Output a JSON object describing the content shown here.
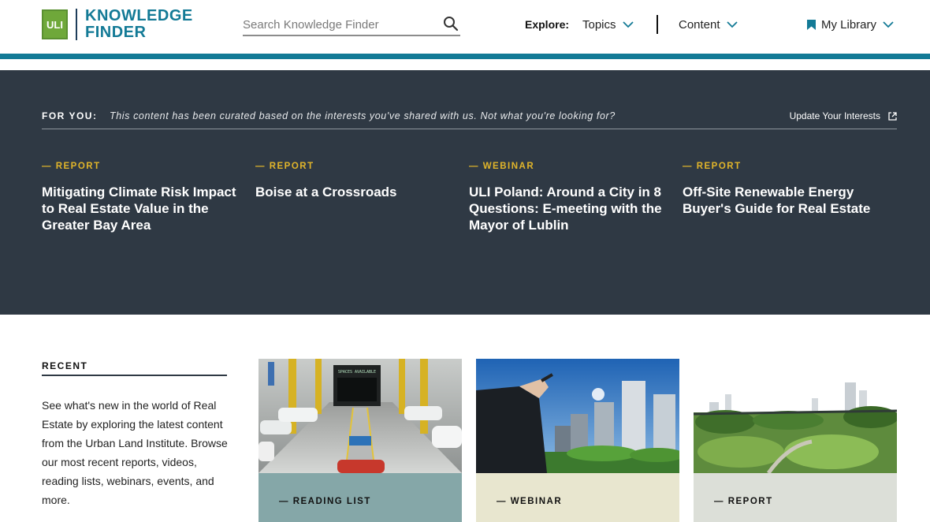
{
  "header": {
    "logo_box": "ULI",
    "logo_line1": "KNOWLEDGE",
    "logo_line2": "FINDER",
    "search_placeholder": "Search Knowledge Finder",
    "explore_label": "Explore:",
    "topics_label": "Topics",
    "content_label": "Content",
    "library_label": "My Library"
  },
  "for_you": {
    "label": "FOR YOU:",
    "description": "This content has been curated based on the interests you've shared with us. Not what you're looking for?",
    "update_label": "Update Your Interests",
    "cards": [
      {
        "tag": "— REPORT",
        "title": "Mitigating Climate Risk Impact to Real Estate Value in the Greater Bay Area"
      },
      {
        "tag": "— REPORT",
        "title": "Boise at a Crossroads"
      },
      {
        "tag": "— WEBINAR",
        "title": "ULI Poland: Around a City in 8 Questions: E-meeting with the Mayor of Lublin"
      },
      {
        "tag": "— REPORT",
        "title": "Off-Site Renewable Energy Buyer's Guide for Real Estate"
      }
    ]
  },
  "recent": {
    "label": "RECENT",
    "text": "See what's new in the world of Real Estate by exploring the latest content from the Urban Land Institute. Browse our most recent reports, videos, reading lists, webinars, events, and more.",
    "tiles": [
      {
        "tag": "— READING LIST",
        "band_color": "#85a7a8"
      },
      {
        "tag": "— WEBINAR",
        "band_color": "#e8e6cf"
      },
      {
        "tag": "— REPORT",
        "band_color": "#dcdfd8"
      }
    ]
  },
  "colors": {
    "accent_teal": "#137a96",
    "dark_panel": "#2f3944",
    "tag_yellow": "#e1b52a",
    "logo_green": "#6fa83a"
  }
}
